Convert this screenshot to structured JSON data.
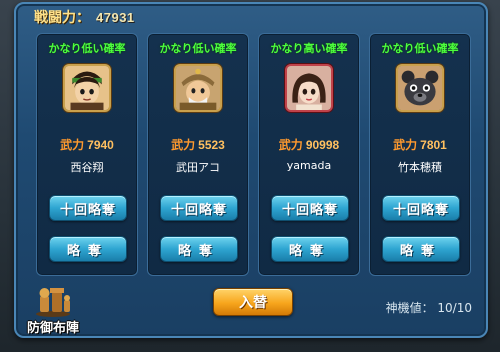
{
  "header": {
    "power_label": "戦闘力：",
    "power_value": "47931"
  },
  "opponents": [
    {
      "probability": "かなり低い確率",
      "stat_label": "武力",
      "stat_value": "7940",
      "name": "西谷翔",
      "icon": "warrior-avatar-icon"
    },
    {
      "probability": "かなり低い確率",
      "stat_label": "武力",
      "stat_value": "5523",
      "name": "武田アコ",
      "icon": "armored-general-avatar-icon"
    },
    {
      "probability": "かなり高い確率",
      "stat_label": "武力",
      "stat_value": "90998",
      "name": "yamada",
      "icon": "female-avatar-icon"
    },
    {
      "probability": "かなり低い確率",
      "stat_label": "武力",
      "stat_value": "7801",
      "name": "竹本穂積",
      "icon": "panda-avatar-icon"
    }
  ],
  "buttons": {
    "ten_plunder": "十回略奪",
    "plunder": "略奪"
  },
  "footer": {
    "swap_label": "入替",
    "machine_value": "神機値： 10/10",
    "defense_label": "防御布陣"
  },
  "colors": {
    "probability_text": "#4cff3d",
    "stat_label": "#ff9a2e",
    "button_blue": "#2ea5d1",
    "swap_orange": "#f7a51c"
  }
}
